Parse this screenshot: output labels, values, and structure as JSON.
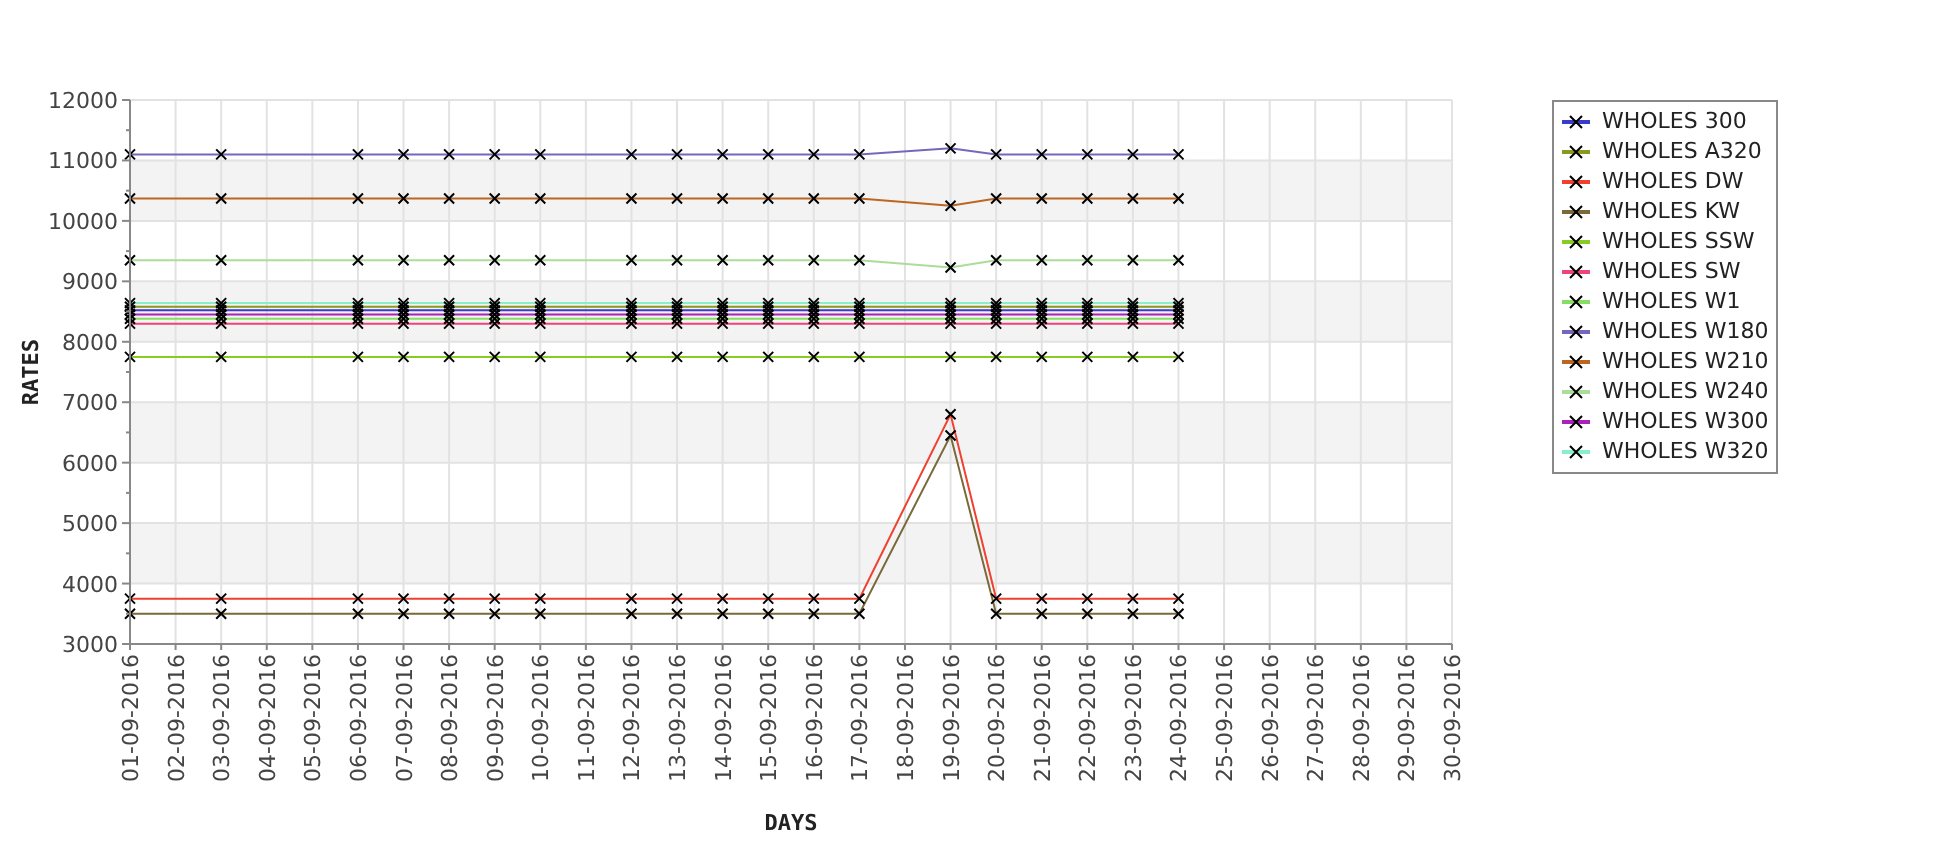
{
  "chart_data": {
    "type": "line",
    "grid": true,
    "legend": true,
    "xlabel": "DAYS",
    "ylabel": "RATES",
    "ylim": [
      3000,
      12000
    ],
    "yticks": [
      3000,
      4000,
      5000,
      6000,
      7000,
      8000,
      9000,
      10000,
      11000,
      12000
    ],
    "categories": [
      "01-09-2016",
      "02-09-2016",
      "03-09-2016",
      "04-09-2016",
      "05-09-2016",
      "06-09-2016",
      "07-09-2016",
      "08-09-2016",
      "09-09-2016",
      "10-09-2016",
      "11-09-2016",
      "12-09-2016",
      "13-09-2016",
      "14-09-2016",
      "15-09-2016",
      "16-09-2016",
      "17-09-2016",
      "18-09-2016",
      "19-09-2016",
      "20-09-2016",
      "21-09-2016",
      "22-09-2016",
      "23-09-2016",
      "24-09-2016",
      "25-09-2016",
      "26-09-2016",
      "27-09-2016",
      "28-09-2016",
      "29-09-2016",
      "30-09-2016"
    ],
    "series": [
      {
        "name": "WHOLES 300",
        "color": "#3a3acc",
        "marker": "x",
        "values": [
          8520,
          null,
          8520,
          null,
          null,
          8520,
          8520,
          8520,
          8520,
          8520,
          null,
          8520,
          8520,
          8520,
          8520,
          8520,
          8520,
          null,
          8520,
          8520,
          8520,
          8520,
          8520,
          8520,
          null,
          null,
          null,
          null,
          null,
          null
        ]
      },
      {
        "name": "WHOLES A320",
        "color": "#8a9a1a",
        "marker": "x",
        "values": [
          8580,
          null,
          8580,
          null,
          null,
          8580,
          8580,
          8580,
          8580,
          8580,
          null,
          8580,
          8580,
          8580,
          8580,
          8580,
          8580,
          null,
          8580,
          8580,
          8580,
          8580,
          8580,
          8580,
          null,
          null,
          null,
          null,
          null,
          null
        ]
      },
      {
        "name": "WHOLES DW",
        "color": "#f04030",
        "marker": "x",
        "values": [
          3750,
          null,
          3750,
          null,
          null,
          3750,
          3750,
          3750,
          3750,
          3750,
          null,
          3750,
          3750,
          3750,
          3750,
          3750,
          3750,
          null,
          6800,
          3750,
          3750,
          3750,
          3750,
          3750,
          null,
          null,
          null,
          null,
          null,
          null
        ]
      },
      {
        "name": "WHOLES KW",
        "color": "#7a6a3a",
        "marker": "x",
        "values": [
          3500,
          null,
          3500,
          null,
          null,
          3500,
          3500,
          3500,
          3500,
          3500,
          null,
          3500,
          3500,
          3500,
          3500,
          3500,
          3500,
          null,
          6450,
          3500,
          3500,
          3500,
          3500,
          3500,
          null,
          null,
          null,
          null,
          null,
          null
        ]
      },
      {
        "name": "WHOLES SSW",
        "color": "#88cc22",
        "marker": "x",
        "values": [
          7750,
          null,
          7750,
          null,
          null,
          7750,
          7750,
          7750,
          7750,
          7750,
          null,
          7750,
          7750,
          7750,
          7750,
          7750,
          7750,
          null,
          7750,
          7750,
          7750,
          7750,
          7750,
          7750,
          null,
          null,
          null,
          null,
          null,
          null
        ]
      },
      {
        "name": "WHOLES SW",
        "color": "#ee4477",
        "marker": "x",
        "values": [
          8300,
          null,
          8300,
          null,
          null,
          8300,
          8300,
          8300,
          8300,
          8300,
          null,
          8300,
          8300,
          8300,
          8300,
          8300,
          8300,
          null,
          8300,
          8300,
          8300,
          8300,
          8300,
          8300,
          null,
          null,
          null,
          null,
          null,
          null
        ]
      },
      {
        "name": "WHOLES W1",
        "color": "#88dd66",
        "marker": "x",
        "values": [
          8380,
          null,
          8380,
          null,
          null,
          8380,
          8380,
          8380,
          8380,
          8380,
          null,
          8380,
          8380,
          8380,
          8380,
          8380,
          8380,
          null,
          8380,
          8380,
          8380,
          8380,
          8380,
          8380,
          null,
          null,
          null,
          null,
          null,
          null
        ]
      },
      {
        "name": "WHOLES W180",
        "color": "#7766bb",
        "marker": "x",
        "values": [
          11100,
          null,
          11100,
          null,
          null,
          11100,
          11100,
          11100,
          11100,
          11100,
          null,
          11100,
          11100,
          11100,
          11100,
          11100,
          11100,
          null,
          11200,
          11100,
          11100,
          11100,
          11100,
          11100,
          null,
          null,
          null,
          null,
          null,
          null
        ]
      },
      {
        "name": "WHOLES W210",
        "color": "#bb6622",
        "marker": "x",
        "values": [
          10370,
          null,
          10370,
          null,
          null,
          10370,
          10370,
          10370,
          10370,
          10370,
          null,
          10370,
          10370,
          10370,
          10370,
          10370,
          10370,
          null,
          10250,
          10370,
          10370,
          10370,
          10370,
          10370,
          null,
          null,
          null,
          null,
          null,
          null
        ]
      },
      {
        "name": "WHOLES W240",
        "color": "#aadd99",
        "marker": "x",
        "values": [
          9350,
          null,
          9350,
          null,
          null,
          9350,
          9350,
          9350,
          9350,
          9350,
          null,
          9350,
          9350,
          9350,
          9350,
          9350,
          9350,
          null,
          9230,
          9350,
          9350,
          9350,
          9350,
          9350,
          null,
          null,
          null,
          null,
          null,
          null
        ]
      },
      {
        "name": "WHOLES W300",
        "color": "#aa22bb",
        "marker": "x",
        "values": [
          8450,
          null,
          8450,
          null,
          null,
          8450,
          8450,
          8450,
          8450,
          8450,
          null,
          8450,
          8450,
          8450,
          8450,
          8450,
          8450,
          null,
          8450,
          8450,
          8450,
          8450,
          8450,
          8450,
          null,
          null,
          null,
          null,
          null,
          null
        ]
      },
      {
        "name": "WHOLES W320",
        "color": "#88eecc",
        "marker": "x",
        "values": [
          8640,
          null,
          8640,
          null,
          null,
          8640,
          8640,
          8640,
          8640,
          8640,
          null,
          8640,
          8640,
          8640,
          8640,
          8640,
          8640,
          null,
          8640,
          8640,
          8640,
          8640,
          8640,
          8640,
          null,
          null,
          null,
          null,
          null,
          null
        ]
      }
    ]
  }
}
